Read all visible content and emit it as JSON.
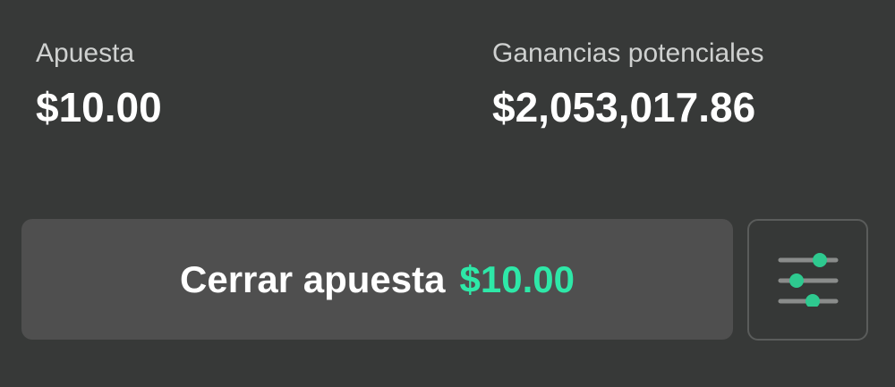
{
  "bet": {
    "label": "Apuesta",
    "value": "$10.00"
  },
  "potential_winnings": {
    "label": "Ganancias potenciales",
    "value": "$2,053,017.86"
  },
  "close_bet_button": {
    "label": "Cerrar apuesta",
    "amount": "$10.00"
  },
  "settings_button": {
    "icon": "sliders-icon"
  },
  "colors": {
    "background": "#373938",
    "button": "#4f4f4f",
    "accent": "#2ee8a8"
  }
}
